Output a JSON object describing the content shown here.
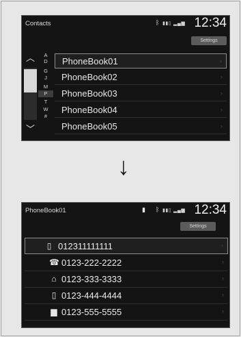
{
  "screen1": {
    "title": "Contacts",
    "time": "12:34",
    "settings_label": "Settings",
    "alpha_index": [
      "A",
      "D",
      "G",
      "J",
      "M",
      "P",
      "T",
      "W",
      "#"
    ],
    "contacts": [
      "PhoneBook01",
      "PhoneBook02",
      "PhoneBook03",
      "PhoneBook04",
      "PhoneBook05"
    ]
  },
  "arrow": "↓",
  "screen2": {
    "title": "PhoneBook01",
    "time": "12:34",
    "settings_label": "Settings",
    "numbers": [
      {
        "icon": "mobile-phone-icon",
        "glyph": "▯",
        "number": "012311111111"
      },
      {
        "icon": "home-phone-icon",
        "glyph": "☎",
        "number": "0123-222-2222"
      },
      {
        "icon": "house-icon",
        "glyph": "⌂",
        "number": "0123-333-3333"
      },
      {
        "icon": "mobile-phone-icon",
        "glyph": "▯",
        "number": "0123-444-4444"
      },
      {
        "icon": "work-building-icon",
        "glyph": "▆",
        "number": "0123-555-5555"
      }
    ]
  }
}
